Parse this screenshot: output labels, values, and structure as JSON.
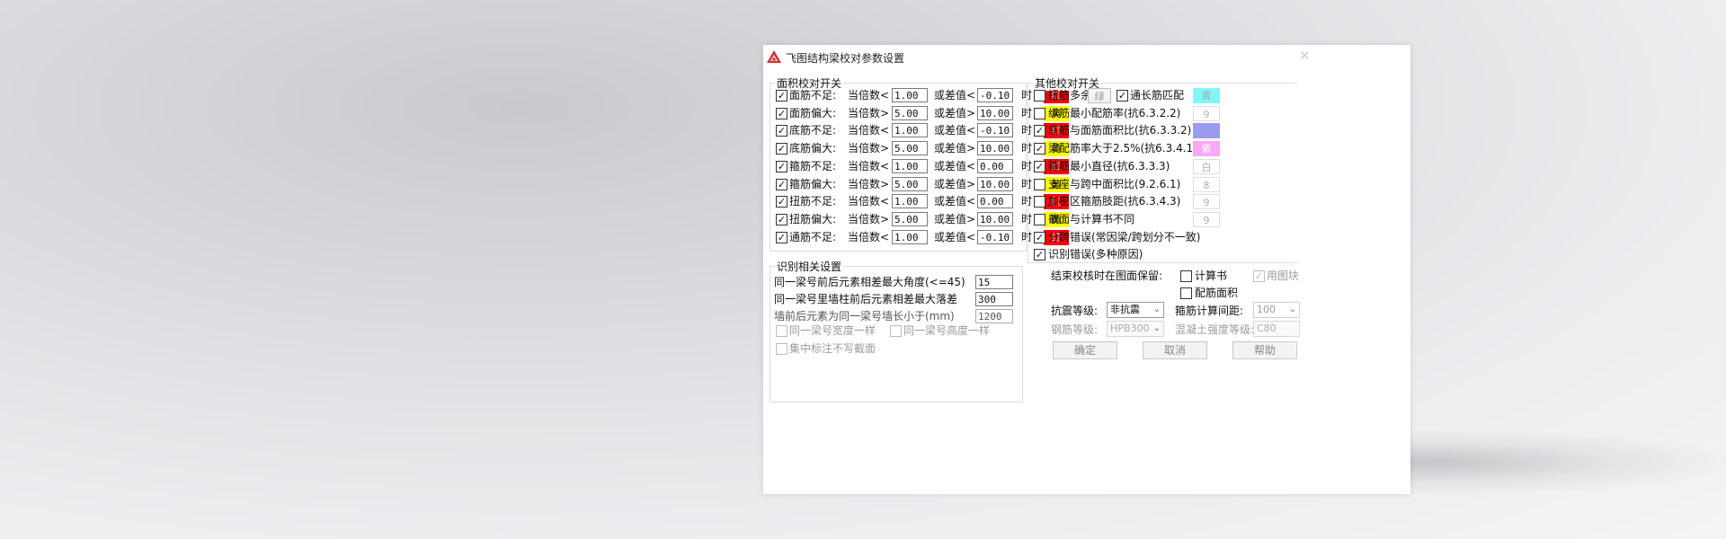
{
  "window": {
    "title": "飞图结构梁校对参数设置",
    "close_glyph": "✕",
    "icon": "app-logo-icon"
  },
  "area_check": {
    "legend": "面积校对开关",
    "rows": [
      {
        "checked": true,
        "name": "面筋不足:",
        "cond": "当倍数<",
        "ratio": "1.00",
        "diff_label": "或差值<",
        "diff": "-0.10",
        "when": "时",
        "color_label": "红",
        "color": "#ff0000"
      },
      {
        "checked": true,
        "name": "面筋偏大:",
        "cond": "当倍数>",
        "ratio": "5.00",
        "diff_label": "或差值>",
        "diff": "10.00",
        "when": "时",
        "color_label": "黄",
        "color": "#ffff00"
      },
      {
        "checked": true,
        "name": "底筋不足:",
        "cond": "当倍数<",
        "ratio": "1.00",
        "diff_label": "或差值<",
        "diff": "-0.10",
        "when": "时",
        "color_label": "红",
        "color": "#ff0000"
      },
      {
        "checked": true,
        "name": "底筋偏大:",
        "cond": "当倍数>",
        "ratio": "5.00",
        "diff_label": "或差值>",
        "diff": "10.00",
        "when": "时",
        "color_label": "黄",
        "color": "#ffff00"
      },
      {
        "checked": true,
        "name": "箍筋不足:",
        "cond": "当倍数<",
        "ratio": "1.00",
        "diff_label": "或差值<",
        "diff": "0.00",
        "when": "时",
        "color_label": "红",
        "color": "#ff0000"
      },
      {
        "checked": true,
        "name": "箍筋偏大:",
        "cond": "当倍数>",
        "ratio": "5.00",
        "diff_label": "或差值>",
        "diff": "10.00",
        "when": "时",
        "color_label": "黄",
        "color": "#ffff00"
      },
      {
        "checked": true,
        "name": "扭筋不足:",
        "cond": "当倍数<",
        "ratio": "1.00",
        "diff_label": "或差值<",
        "diff": "0.00",
        "when": "时",
        "color_label": "红",
        "color": "#ff0000"
      },
      {
        "checked": true,
        "name": "扭筋偏大:",
        "cond": "当倍数>",
        "ratio": "5.00",
        "diff_label": "或差值>",
        "diff": "10.00",
        "when": "时",
        "color_label": "黄",
        "color": "#ffff00"
      },
      {
        "checked": true,
        "name": "通筋不足:",
        "cond": "当倍数<",
        "ratio": "1.00",
        "diff_label": "或差值<",
        "diff": "-0.10",
        "when": "时",
        "color_label": "红",
        "color": "#ff0000"
      }
    ]
  },
  "other_check": {
    "legend": "其他校对开关",
    "rows": [
      {
        "checked": false,
        "label": "扭筋多余",
        "value": "绿",
        "extra_checked": true,
        "extra_label": "通长筋匹配",
        "extra_value": "青",
        "extra_color": "#7ff7f7"
      },
      {
        "checked": false,
        "label": "纵筋最小配筋率(抗6.3.2.2)",
        "value": "9",
        "color": "#ffffff"
      },
      {
        "checked": true,
        "label": "底筋与面筋面积比(抗6.3.3.2)",
        "value": "",
        "color": "#9b9bf0"
      },
      {
        "checked": true,
        "label": "梁配筋率大于2.5%(抗6.3.4.1)",
        "value": "紫",
        "color": "#f7a8f7"
      },
      {
        "checked": true,
        "label": "箍筋最小直径(抗6.3.3.3)",
        "value": "白",
        "color": "#ffffff"
      },
      {
        "checked": false,
        "label": "支座与跨中面积比(9.2.6.1)",
        "value": "8",
        "color": "#ffffff"
      },
      {
        "checked": false,
        "label": "加密区箍筋肢距(抗6.3.4.3)",
        "value": "9",
        "color": "#ffffff"
      },
      {
        "checked": false,
        "label": "截面与计算书不同",
        "value": "9",
        "color": "#ffffff"
      },
      {
        "checked": true,
        "label": "分跨错误(常因梁/跨划分不一致)"
      },
      {
        "checked": true,
        "label": "识别错误(多种原因)"
      }
    ]
  },
  "recognition": {
    "legend": "识别相关设置",
    "rows": [
      {
        "label": "同一梁号前后元素相差最大角度(<=45)",
        "value": "15"
      },
      {
        "label": "同一梁号里墙柱前后元素相差最大落差",
        "value": "300"
      },
      {
        "label": "墙前后元素为同一梁号墙长小于(mm)",
        "value": "1200"
      }
    ],
    "same_width": {
      "checked": false,
      "label": "同一梁号宽度一样"
    },
    "same_height": {
      "checked": false,
      "label": "同一梁号高度一样"
    },
    "centralized": {
      "checked": false,
      "label": "集中标注不写截面"
    }
  },
  "keep_after": {
    "label": "结束校核时在图面保留:",
    "calc_book": {
      "checked": false,
      "label": "计算书"
    },
    "rebar_area": {
      "checked": false,
      "label": "配筋面积"
    },
    "use_block": {
      "checked": true,
      "label": "用图块"
    }
  },
  "params": {
    "seismic_label": "抗震等级:",
    "seismic_value": "非抗震",
    "stirrup_spacing_label": "箍筋计算间距:",
    "stirrup_spacing_value": "100",
    "rebar_grade_label": "钢筋等级:",
    "rebar_grade_value": "HPB300",
    "concrete_label": "混凝土强度等级:",
    "concrete_value": "C80"
  },
  "buttons": {
    "ok": "确定",
    "cancel": "取消",
    "help": "帮助"
  }
}
